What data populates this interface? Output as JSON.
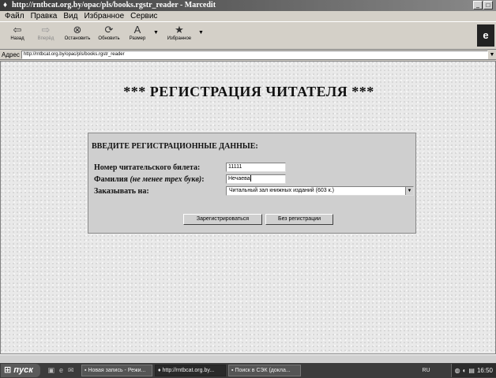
{
  "window": {
    "title": "http://rntbcat.org.by/opac/pls/books.rgstr_reader - Marcedit",
    "buttons": [
      "_",
      "□"
    ]
  },
  "menu": [
    "Файл",
    "Правка",
    "Вид",
    "Избранное",
    "Сервис"
  ],
  "toolbar": {
    "back": "Назад",
    "forward": "Вперёд",
    "stop": "Остановить",
    "refresh": "Обновить",
    "size": "Размер",
    "favorites": "Избранное"
  },
  "address": {
    "label": "Адрес",
    "url": "http://rntbcat.org.by/opac/pls/books.rgstr_reader"
  },
  "page": {
    "title": "*** РЕГИСТРАЦИЯ ЧИТАТЕЛЯ ***",
    "heading": "ВВЕДИТЕ РЕГИСТРАЦИОННЫЕ ДАННЫЕ:",
    "card_label": "Номер читательского билета:",
    "card_value": "11111",
    "surname_label": "Фамилия",
    "surname_hint": "(не менее трех букв)",
    "surname_colon": ":",
    "surname_value": "Нечаева",
    "order_label": "Заказывать на:",
    "order_value": "Читальный зал книжных изданий (603 к.)",
    "register_button": "Зарегистрироваться",
    "noreg_button": "Без регистрации"
  },
  "taskbar": {
    "start": "пуск",
    "tasks": [
      "Новая запись - Режи...",
      "http://rntbcat.org.by...",
      "Поиск в СЭК (докла..."
    ],
    "lang": "RU",
    "clock": "16:50"
  }
}
